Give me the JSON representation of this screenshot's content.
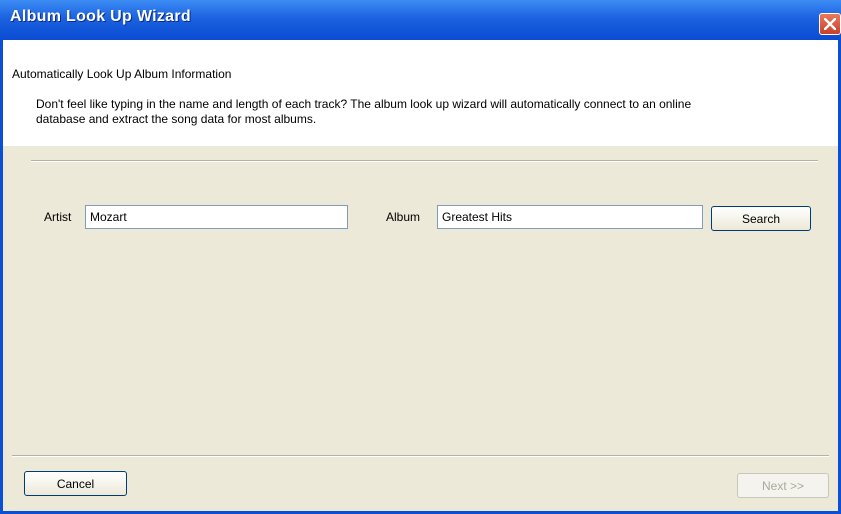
{
  "window": {
    "title": "Album Look Up Wizard"
  },
  "header": {
    "heading": "Automatically Look Up Album Information",
    "description": "Don't feel like typing in the name and length of each track?  The album look up wizard will automatically connect to an online database and extract the song data for most albums."
  },
  "form": {
    "artist_label": "Artist",
    "artist_value": "Mozart",
    "album_label": "Album",
    "album_value": "Greatest Hits",
    "search_label": "Search"
  },
  "footer": {
    "cancel_label": "Cancel",
    "next_label": "Next >>"
  },
  "colors": {
    "titlebar": "#0a4bd2",
    "close_button": "#c8402a",
    "dialog_background": "#ece9d8"
  },
  "icons": {
    "close": "close-icon"
  }
}
